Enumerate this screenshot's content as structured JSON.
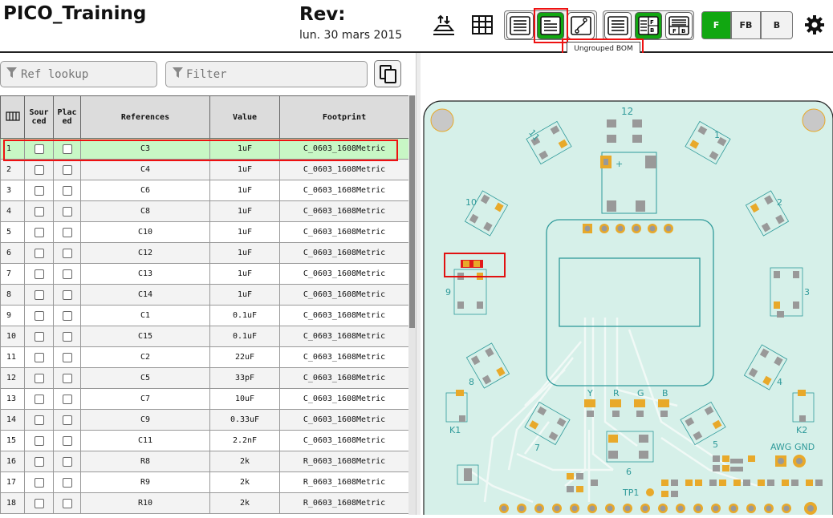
{
  "header": {
    "title": "PICO_Training",
    "rev_label": "Rev:",
    "date": "lun. 30 mars 2015"
  },
  "toolbar": {
    "tooltip": "Ungrouped BOM",
    "layer_buttons": [
      "F",
      "FB",
      "B"
    ],
    "active_layer": "F",
    "active_color": "#11a711",
    "highlight_color": "#e11111"
  },
  "search": {
    "lookup_placeholder": "Ref lookup",
    "filter_placeholder": "Filter"
  },
  "table": {
    "columns": [
      "Sourced",
      "Placed",
      "References",
      "Value",
      "Footprint"
    ],
    "col_sourced_a": "Sour",
    "col_sourced_b": "ced",
    "col_placed_a": "Plac",
    "col_placed_b": "ed",
    "rows": [
      {
        "num": "1",
        "ref": "C3",
        "value": "1uF",
        "footprint": "C_0603_1608Metric"
      },
      {
        "num": "2",
        "ref": "C4",
        "value": "1uF",
        "footprint": "C_0603_1608Metric"
      },
      {
        "num": "3",
        "ref": "C6",
        "value": "1uF",
        "footprint": "C_0603_1608Metric"
      },
      {
        "num": "4",
        "ref": "C8",
        "value": "1uF",
        "footprint": "C_0603_1608Metric"
      },
      {
        "num": "5",
        "ref": "C10",
        "value": "1uF",
        "footprint": "C_0603_1608Metric"
      },
      {
        "num": "6",
        "ref": "C12",
        "value": "1uF",
        "footprint": "C_0603_1608Metric"
      },
      {
        "num": "7",
        "ref": "C13",
        "value": "1uF",
        "footprint": "C_0603_1608Metric"
      },
      {
        "num": "8",
        "ref": "C14",
        "value": "1uF",
        "footprint": "C_0603_1608Metric"
      },
      {
        "num": "9",
        "ref": "C1",
        "value": "0.1uF",
        "footprint": "C_0603_1608Metric"
      },
      {
        "num": "10",
        "ref": "C15",
        "value": "0.1uF",
        "footprint": "C_0603_1608Metric"
      },
      {
        "num": "11",
        "ref": "C2",
        "value": "22uF",
        "footprint": "C_0603_1608Metric"
      },
      {
        "num": "12",
        "ref": "C5",
        "value": "33pF",
        "footprint": "C_0603_1608Metric"
      },
      {
        "num": "13",
        "ref": "C7",
        "value": "10uF",
        "footprint": "C_0603_1608Metric"
      },
      {
        "num": "14",
        "ref": "C9",
        "value": "0.33uF",
        "footprint": "C_0603_1608Metric"
      },
      {
        "num": "15",
        "ref": "C11",
        "value": "2.2nF",
        "footprint": "C_0603_1608Metric"
      },
      {
        "num": "16",
        "ref": "R8",
        "value": "2k",
        "footprint": "R_0603_1608Metric"
      },
      {
        "num": "17",
        "ref": "R9",
        "value": "2k",
        "footprint": "R_0603_1608Metric"
      },
      {
        "num": "18",
        "ref": "R10",
        "value": "2k",
        "footprint": "R_0603_1608Metric"
      }
    ]
  },
  "pcb": {
    "labels": {
      "n12": "12",
      "n11": "11",
      "n1": "1",
      "n10": "10",
      "n2": "2",
      "n9": "9",
      "n3": "3",
      "n8": "8",
      "n4": "4",
      "n7": "7",
      "n5": "5",
      "n6": "6",
      "k1": "K1",
      "k2": "K2",
      "y": "Y",
      "r": "R",
      "g": "G",
      "b": "B",
      "awg": "AWG",
      "gnd": "GND",
      "tp1": "TP1",
      "plus": "+"
    },
    "board_color": "#d6f0e9",
    "silk_color": "#2f9a9a",
    "pad_color": "#e8a92a"
  }
}
